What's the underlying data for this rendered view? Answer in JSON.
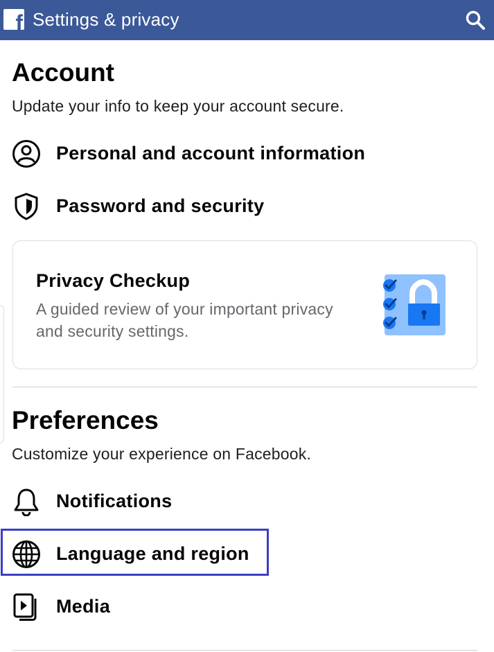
{
  "header": {
    "title": "Settings & privacy",
    "logo_icon": "facebook-logo-icon",
    "search_icon": "search-icon",
    "bg_color": "#3b5998"
  },
  "account": {
    "title": "Account",
    "subtitle": "Update your info to keep your account secure.",
    "items": [
      {
        "label": "Personal and account information",
        "icon": "person-circle-icon"
      },
      {
        "label": "Password and security",
        "icon": "shield-icon"
      }
    ]
  },
  "privacy_checkup": {
    "title": "Privacy Checkup",
    "description": "A guided review of your important privacy and security settings.",
    "icon": "lock-checklist-icon"
  },
  "preferences": {
    "title": "Preferences",
    "subtitle": "Customize your experience on Facebook.",
    "items": [
      {
        "label": "Notifications",
        "icon": "bell-icon"
      },
      {
        "label": "Language and region",
        "icon": "globe-icon",
        "highlighted": true
      },
      {
        "label": "Media",
        "icon": "media-icon"
      }
    ]
  },
  "colors": {
    "highlight_border": "#3a3fc4",
    "illustration_blue": "#1877f2",
    "illustration_light": "#8fc1ff"
  }
}
